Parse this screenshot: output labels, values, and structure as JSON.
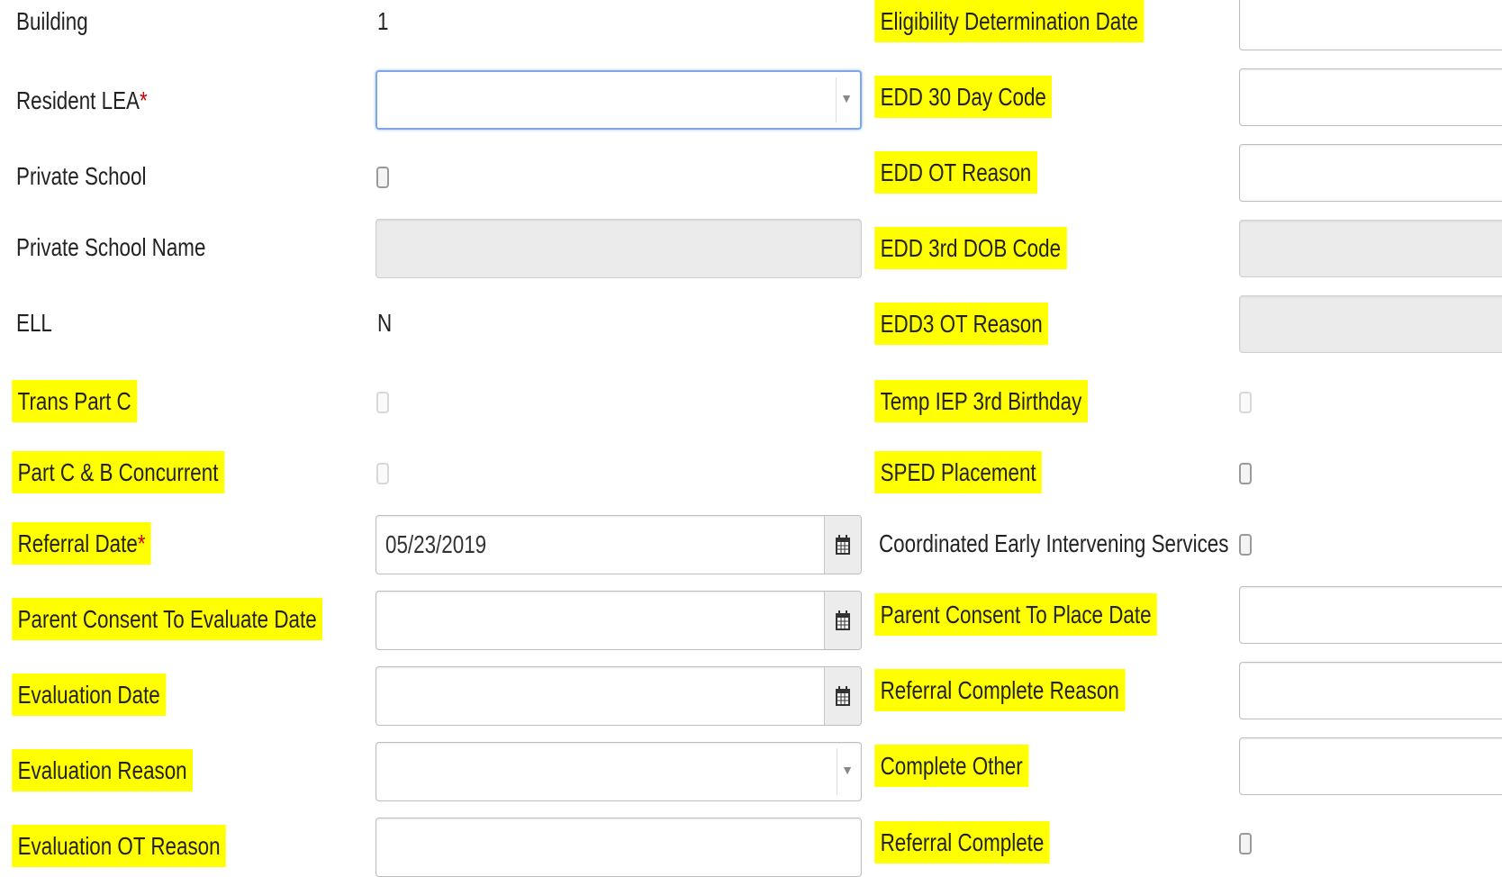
{
  "left": {
    "building": {
      "label": "Building",
      "value": "1"
    },
    "resident_lea": {
      "label": "Resident LEA",
      "required": "*",
      "value": ""
    },
    "private_school": {
      "label": "Private School"
    },
    "private_school_name": {
      "label": "Private School Name",
      "value": ""
    },
    "ell": {
      "label": "ELL",
      "value": "N"
    },
    "trans_part_c": {
      "label": "Trans Part C"
    },
    "part_c_b_concurrent": {
      "label": "Part C & B Concurrent"
    },
    "referral_date": {
      "label": "Referral Date",
      "required": "*",
      "value": "05/23/2019"
    },
    "parent_consent_evaluate": {
      "label": "Parent Consent To Evaluate Date",
      "value": ""
    },
    "evaluation_date": {
      "label": "Evaluation Date",
      "value": ""
    },
    "evaluation_reason": {
      "label": "Evaluation Reason",
      "value": ""
    },
    "evaluation_ot_reason": {
      "label": "Evaluation OT Reason",
      "value": ""
    }
  },
  "right": {
    "eligibility_determination_date": {
      "label": "Eligibility Determination Date",
      "value": ""
    },
    "edd_30_day_code": {
      "label": "EDD 30 Day Code",
      "value": ""
    },
    "edd_ot_reason": {
      "label": "EDD OT Reason",
      "value": ""
    },
    "edd_3rd_dob_code": {
      "label": "EDD 3rd DOB Code",
      "value": ""
    },
    "edd3_ot_reason": {
      "label": "EDD3 OT Reason",
      "value": ""
    },
    "temp_iep_3rd_birthday": {
      "label": "Temp IEP 3rd Birthday"
    },
    "sped_placement": {
      "label": "SPED Placement"
    },
    "coordinated_early_intervening": {
      "label": "Coordinated Early Intervening Services"
    },
    "parent_consent_place": {
      "label": "Parent Consent To Place Date",
      "value": ""
    },
    "referral_complete_reason": {
      "label": "Referral Complete Reason",
      "value": ""
    },
    "complete_other": {
      "label": "Complete Other",
      "value": ""
    },
    "referral_complete": {
      "label": "Referral Complete"
    }
  },
  "icons": {
    "dropdown": "chevron-down-icon",
    "date": "calendar-icon"
  },
  "colors": {
    "highlight": "#ffff00",
    "required": "#d00000",
    "focus_border": "#7fa6e6",
    "disabled_bg": "#ebebeb"
  }
}
